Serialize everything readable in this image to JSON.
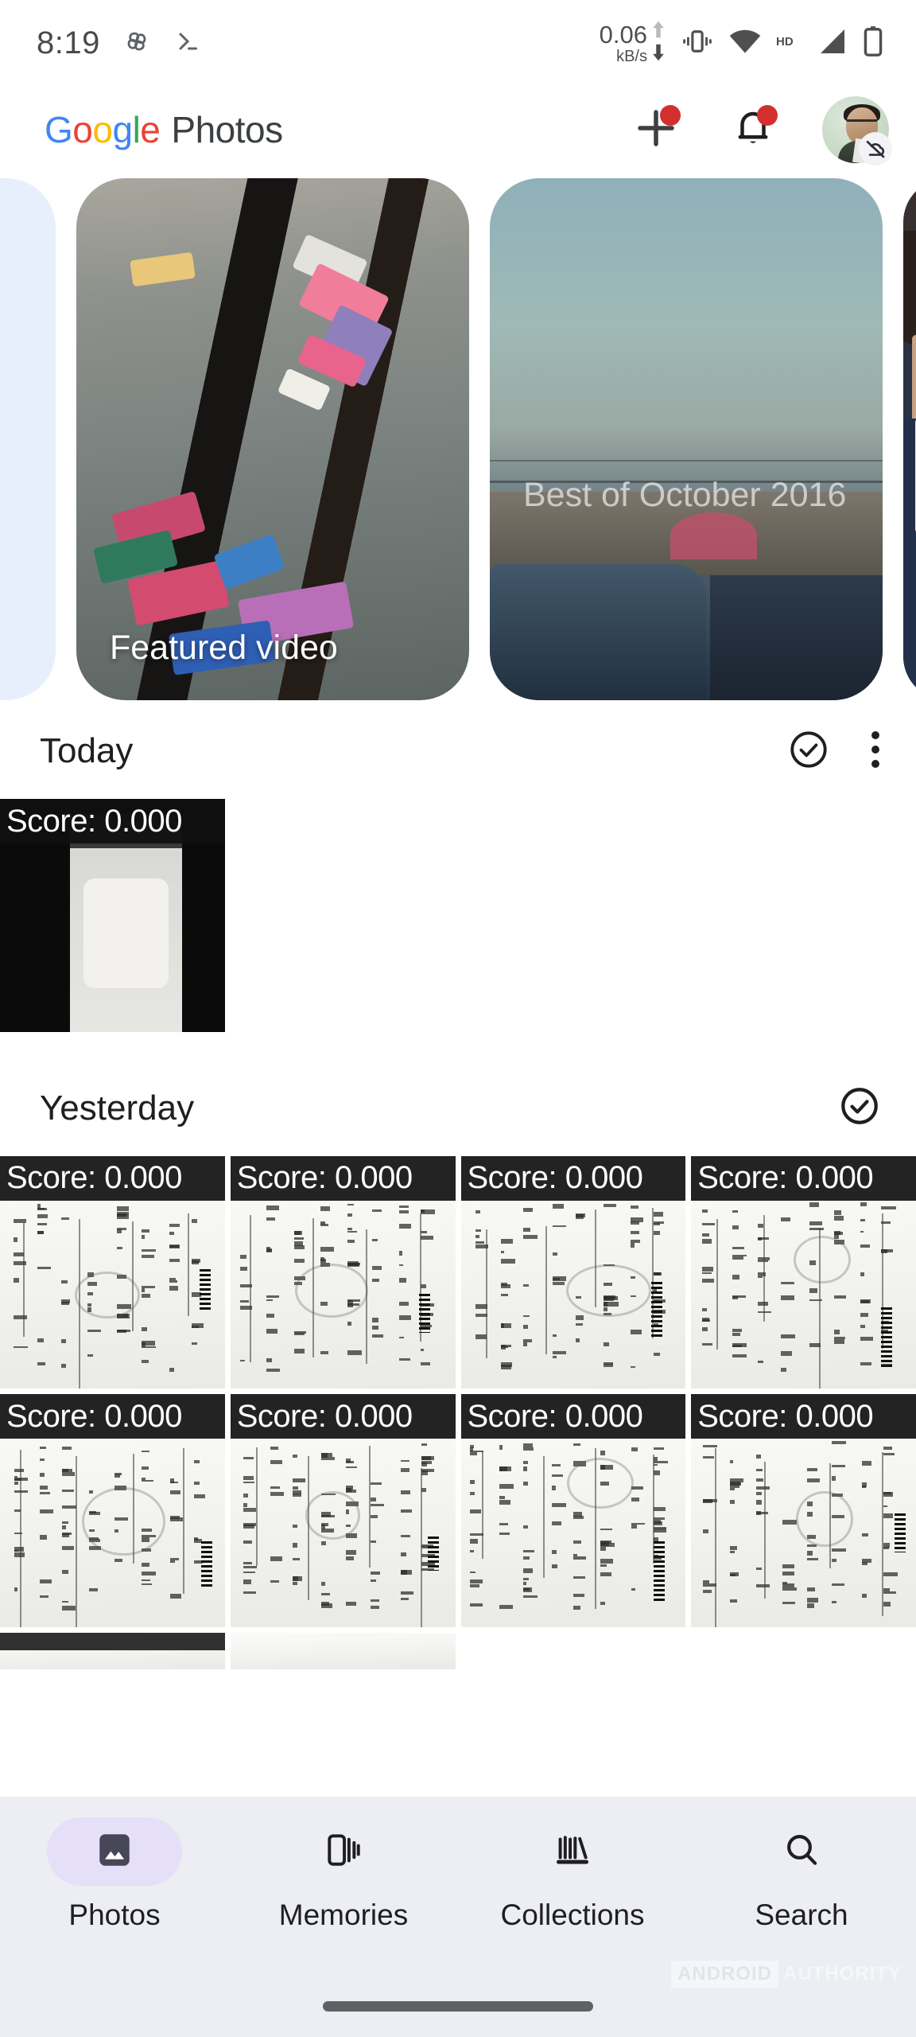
{
  "status_bar": {
    "time": "8:19",
    "left_icons": [
      "pinwheel-icon",
      "terminal-icon"
    ],
    "net_speed_value": "0.06",
    "net_speed_unit": "kB/s",
    "right_icons": [
      "upload-arrow-icon",
      "download-arrow-icon",
      "vibrate-icon",
      "wifi-icon",
      "hd-icon",
      "signal-icon",
      "battery-icon"
    ]
  },
  "app_bar": {
    "brand_google": [
      "G",
      "o",
      "o",
      "g",
      "l",
      "e"
    ],
    "brand_photos": "Photos",
    "add_button_label": "+",
    "icons": [
      "plus-icon",
      "bell-icon",
      "avatar"
    ],
    "badge_color": "#d32f2f",
    "avatar_badge": "cloud-off-icon"
  },
  "memories": {
    "cards": [
      {
        "label": "",
        "kind": "placeholder"
      },
      {
        "label": "Featured video",
        "kind": "video"
      },
      {
        "label": "Best of October 2016",
        "kind": "memory"
      },
      {
        "label": "",
        "kind": "partial"
      }
    ]
  },
  "sections": [
    {
      "title": "Today",
      "has_select_all": true,
      "has_overflow": true,
      "photos": [
        {
          "score": "Score: 0.000",
          "kind": "phone-photo"
        }
      ]
    },
    {
      "title": "Yesterday",
      "has_select_all": true,
      "has_overflow": false,
      "photos": [
        {
          "score": "Score: 0.000",
          "kind": "doc"
        },
        {
          "score": "Score: 0.000",
          "kind": "doc"
        },
        {
          "score": "Score: 0.000",
          "kind": "doc"
        },
        {
          "score": "Score: 0.000",
          "kind": "doc"
        },
        {
          "score": "Score: 0.000",
          "kind": "doc"
        },
        {
          "score": "Score: 0.000",
          "kind": "doc"
        },
        {
          "score": "Score: 0.000",
          "kind": "doc"
        },
        {
          "score": "Score: 0.000",
          "kind": "doc"
        }
      ]
    }
  ],
  "bottom_nav": {
    "active_index": 0,
    "active_pill_color": "#e5e0f7",
    "items": [
      {
        "label": "Photos",
        "icon": "photo-icon"
      },
      {
        "label": "Memories",
        "icon": "memories-cards-icon"
      },
      {
        "label": "Collections",
        "icon": "collections-library-icon"
      },
      {
        "label": "Search",
        "icon": "search-icon"
      }
    ]
  },
  "watermark": {
    "part_a": "ANDROID",
    "part_b": "AUTHORITY"
  }
}
